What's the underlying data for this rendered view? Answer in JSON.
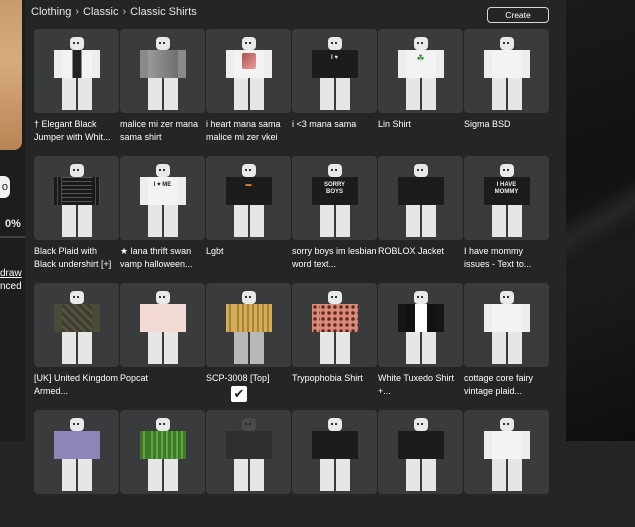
{
  "breadcrumb": [
    "Clothing",
    "Classic",
    "Classic Shirts"
  ],
  "create_label": "Create",
  "left": {
    "button_text": "o",
    "percent": "0%",
    "link1": "draw",
    "link2": "nced"
  },
  "items": [
    {
      "name": "† Elegant Black Jumper with Whit...",
      "variant": "v-elegant"
    },
    {
      "name": "malice mi zer mana sama shirt",
      "variant": "v-grey"
    },
    {
      "name": "i heart mana sama malice mi zer vkei",
      "variant": "v-pic"
    },
    {
      "name": "i <3 mana sama",
      "variant": "v-blackshirt",
      "mark": "I ♥"
    },
    {
      "name": "Lin Shirt",
      "variant": "v-lin",
      "mark": "☘"
    },
    {
      "name": "Sigma BSD",
      "variant": "v-sigma"
    },
    {
      "name": "Black Plaid with Black undershirt [+]",
      "variant": "v-plaid"
    },
    {
      "name": "★ lana thrift swan vamp halloween...",
      "variant": "v-heartme",
      "mark": "I ♥ ME"
    },
    {
      "name": "Lgbt",
      "variant": "v-blackshirt",
      "mark": "▬"
    },
    {
      "name": "sorry boys im lesbian word text...",
      "variant": "v-blackshirt",
      "mark": "SORRY BOYS"
    },
    {
      "name": "ROBLOX Jacket",
      "variant": "v-blackshirt"
    },
    {
      "name": "I have mommy issues - Text to...",
      "variant": "v-blackshirt",
      "mark": "I HAVE MOMMY"
    },
    {
      "name": "[UK] United Kingdom Armed...",
      "variant": "v-olive"
    },
    {
      "name": "Popcat",
      "variant": "v-pink"
    },
    {
      "name": "SCP-3008 [Top]",
      "variant": "v-gold"
    },
    {
      "name": "Trypophobia Shirt",
      "variant": "v-leopard"
    },
    {
      "name": "White Tuxedo Shirt +...",
      "variant": "v-tuxedo"
    },
    {
      "name": "cottage core fairy vintage plaid...",
      "variant": "v-plain"
    },
    {
      "name": "",
      "variant": "v-lavender"
    },
    {
      "name": "",
      "variant": "v-green"
    },
    {
      "name": "",
      "variant": "v-dark"
    },
    {
      "name": "",
      "variant": "v-blackshirt"
    },
    {
      "name": "",
      "variant": "v-blackshirt"
    },
    {
      "name": "",
      "variant": "v-plain"
    }
  ]
}
